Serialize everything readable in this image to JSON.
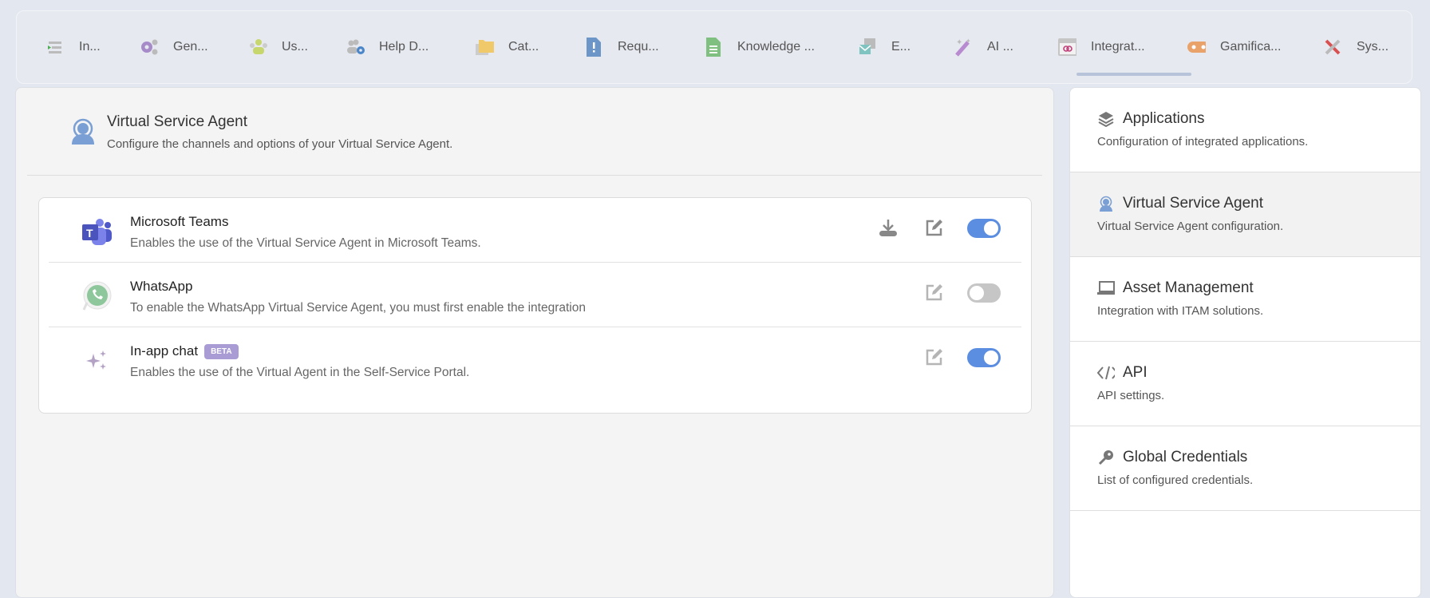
{
  "tabs": [
    {
      "label": "In...",
      "icon": "list-icon"
    },
    {
      "label": "Gen...",
      "icon": "gears-icon"
    },
    {
      "label": "Us...",
      "icon": "users-icon"
    },
    {
      "label": "Help D...",
      "icon": "users-gear-icon"
    },
    {
      "label": "Cat...",
      "icon": "folder-icon"
    },
    {
      "label": "Requ...",
      "icon": "request-document-icon"
    },
    {
      "label": "Knowledge ...",
      "icon": "knowledge-document-icon"
    },
    {
      "label": "E...",
      "icon": "email-icon"
    },
    {
      "label": "AI ...",
      "icon": "magic-wand-icon"
    },
    {
      "label": "Integrat...",
      "icon": "integration-window-icon",
      "active": true
    },
    {
      "label": "Gamifica...",
      "icon": "gamepad-icon"
    },
    {
      "label": "Sys...",
      "icon": "tools-icon"
    }
  ],
  "header": {
    "title": "Virtual Service Agent",
    "subtitle": "Configure the channels and options of your Virtual Service Agent."
  },
  "channels": [
    {
      "name": "Microsoft Teams",
      "description": "Enables the use of the Virtual Service Agent in Microsoft Teams.",
      "enabled": true,
      "has_download": true
    },
    {
      "name": "WhatsApp",
      "description": "To enable the WhatsApp Virtual Service Agent, you must first enable the integration",
      "enabled": false
    },
    {
      "name": "In-app chat",
      "badge": "BETA",
      "description": "Enables the use of the Virtual Agent in the Self-Service Portal.",
      "enabled": true
    }
  ],
  "sidebar": [
    {
      "title": "Applications",
      "description": "Configuration of integrated applications.",
      "icon": "layers-icon"
    },
    {
      "title": "Virtual Service Agent",
      "description": "Virtual Service Agent configuration.",
      "icon": "agent-icon",
      "active": true
    },
    {
      "title": "Asset Management",
      "description": "Integration with ITAM solutions.",
      "icon": "laptop-icon"
    },
    {
      "title": "API",
      "description": "API settings.",
      "icon": "code-icon"
    },
    {
      "title": "Global Credentials",
      "description": "List of configured credentials.",
      "icon": "key-icon"
    }
  ],
  "colors": {
    "accent": "#5b8ee0",
    "toggle_off": "#c6c6c6",
    "beta": "#a99bd3"
  }
}
